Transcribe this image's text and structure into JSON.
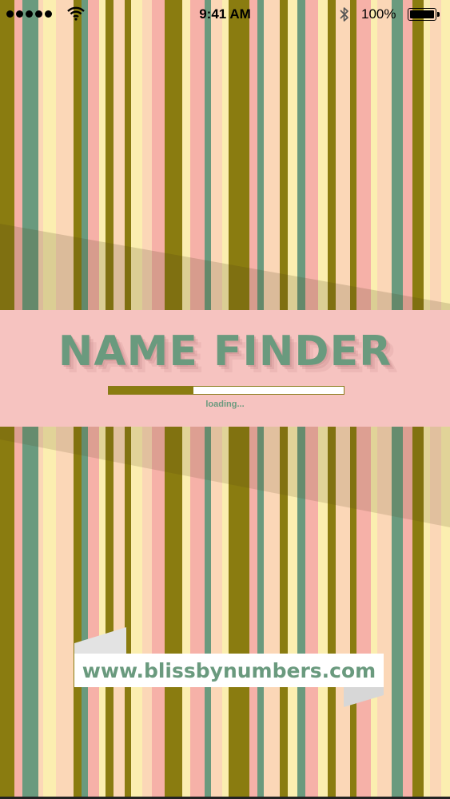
{
  "status_bar": {
    "time": "9:41 AM",
    "battery_percent": "100%",
    "signal_icon": "signal-dots-icon",
    "wifi_icon": "wifi-icon",
    "bluetooth_icon": "bluetooth-icon",
    "battery_icon": "battery-icon"
  },
  "splash": {
    "title": "NAME FINDER",
    "loading_label": "loading...",
    "progress_fraction": 0.36,
    "url": "www.blissbynumbers.com"
  },
  "colors": {
    "olive": "#8a7c10",
    "sage": "#6a9a7e",
    "salmon": "#f6b1a8",
    "pale_yellow": "#fbeeb0",
    "peach": "#fbd7b7",
    "banner": "#f6c3c0"
  }
}
